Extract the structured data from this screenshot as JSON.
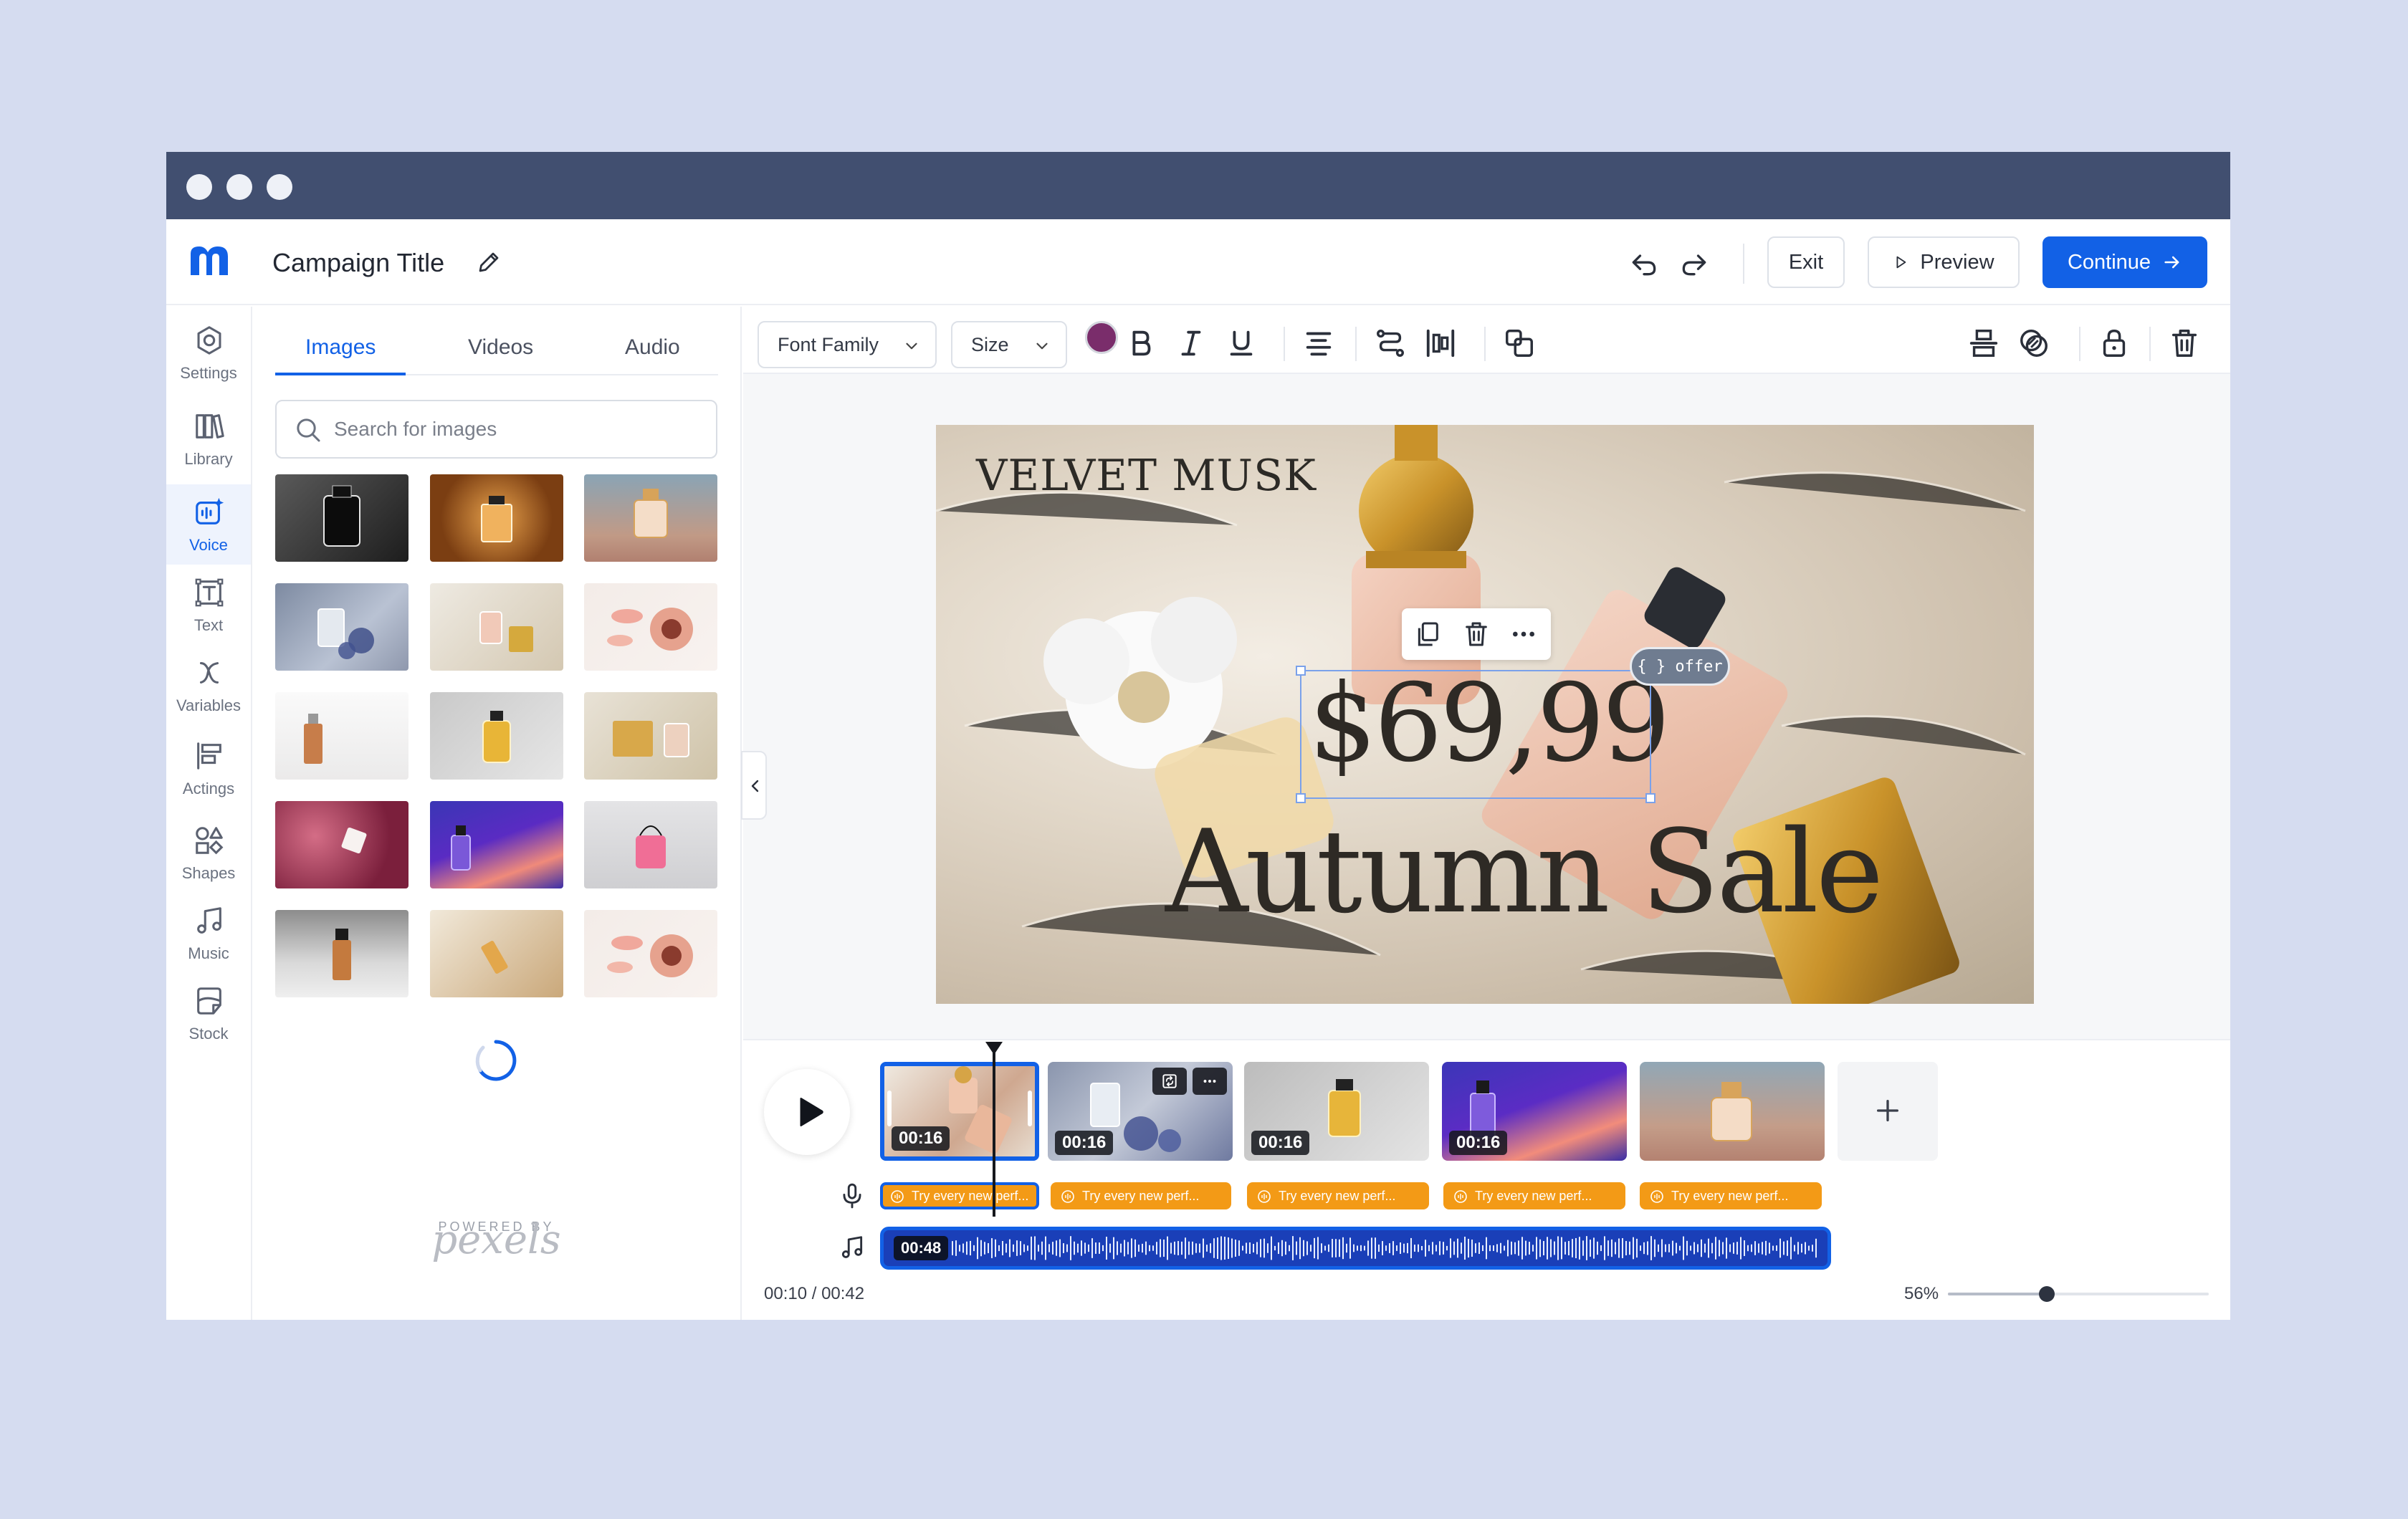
{
  "header": {
    "campaign_title": "Campaign Title",
    "exit_label": "Exit",
    "preview_label": "Preview",
    "continue_label": "Continue"
  },
  "sidebar": {
    "items": [
      {
        "label": "Settings",
        "icon": "gear-icon"
      },
      {
        "label": "Library",
        "icon": "library-icon"
      },
      {
        "label": "Voice",
        "icon": "voice-icon",
        "active": true
      },
      {
        "label": "Text",
        "icon": "text-icon"
      },
      {
        "label": "Variables",
        "icon": "variable-icon"
      },
      {
        "label": "Actings",
        "icon": "actings-icon"
      },
      {
        "label": "Shapes",
        "icon": "shapes-icon"
      },
      {
        "label": "Music",
        "icon": "music-icon"
      },
      {
        "label": "Stock",
        "icon": "stock-icon"
      }
    ]
  },
  "media": {
    "tabs": [
      {
        "label": "Images",
        "active": true
      },
      {
        "label": "Videos"
      },
      {
        "label": "Audio"
      }
    ],
    "search_placeholder": "Search for images",
    "powered_by": "POWERED BY",
    "provider": "pexels"
  },
  "toolbar": {
    "font_family": "Font Family",
    "size": "Size",
    "text_color": "#7a2d6b"
  },
  "canvas": {
    "brand": "VELVET MUSK",
    "price": "$69,99",
    "headline": "Autumn Sale",
    "variable_badge": "{ } offer"
  },
  "timeline": {
    "clips": [
      {
        "duration": "00:16",
        "selected": true
      },
      {
        "duration": "00:16"
      },
      {
        "duration": "00:16"
      },
      {
        "duration": "00:16"
      },
      {
        "duration": ""
      }
    ],
    "voiceovers": [
      "Try every new perf...",
      "Try every new perf...",
      "Try every new perf...",
      "Try every new perf...",
      "Try every new perf..."
    ],
    "audio_duration": "00:48",
    "current_time": "00:10 / 00:42",
    "zoom": "56%",
    "zoom_value": 0.38
  },
  "colors": {
    "accent": "#1261e6",
    "titlebar": "#414f70",
    "voiceover": "#f39a16"
  }
}
